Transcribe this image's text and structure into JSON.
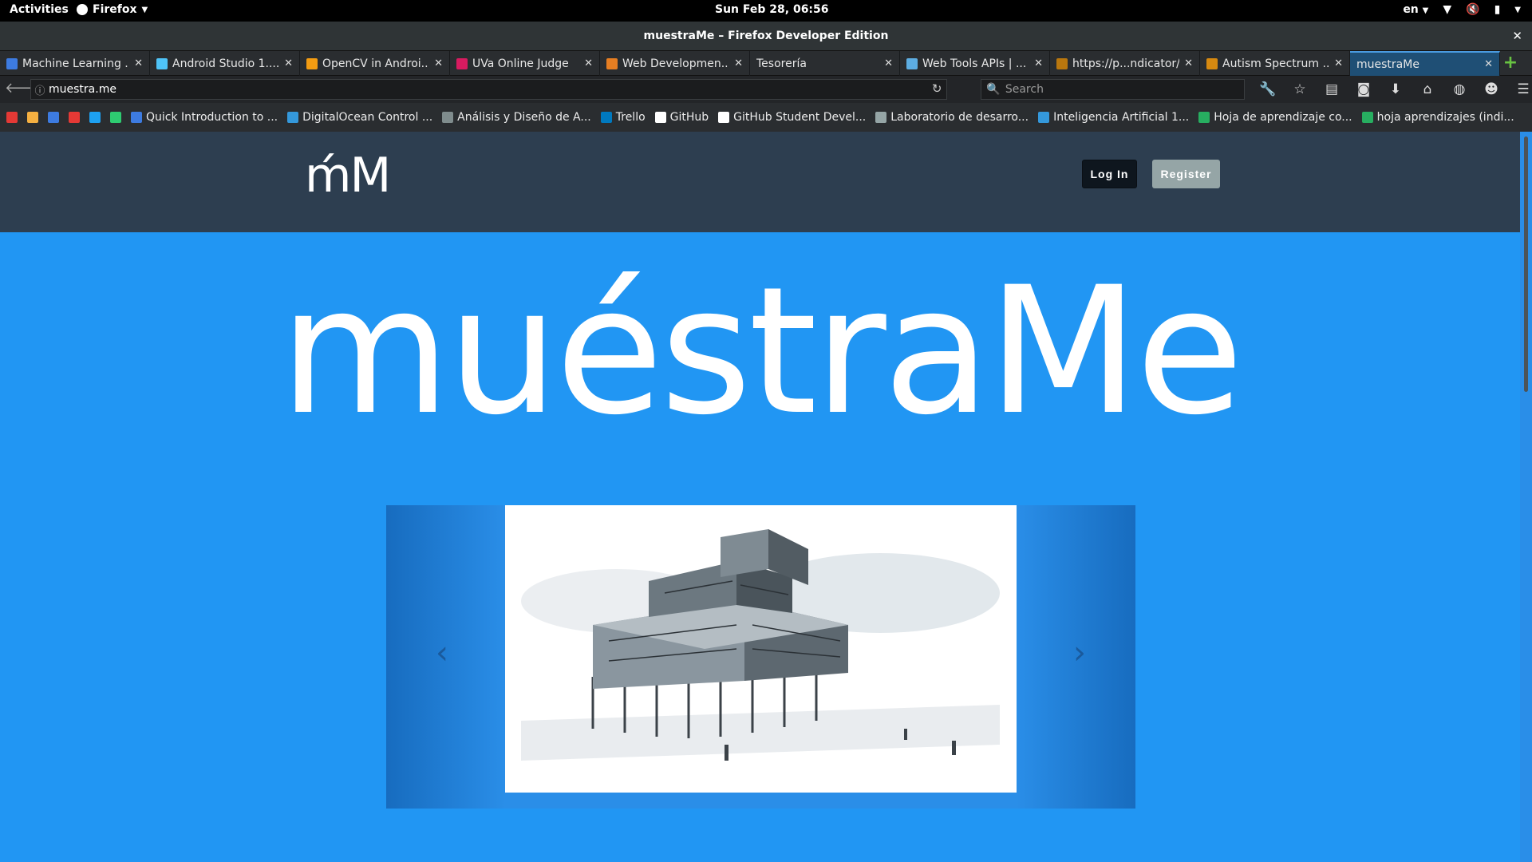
{
  "system_bar": {
    "activities": "Activities",
    "app": "Firefox",
    "clock": "Sun Feb 28, 06:56",
    "lang": "en"
  },
  "window": {
    "title": "muestraMe – Firefox Developer Edition"
  },
  "tabs": [
    {
      "title": "Machine Learning ...",
      "favicon_color": "#3d7be0"
    },
    {
      "title": "Android Studio 1....",
      "favicon_color": "#4fc3f7"
    },
    {
      "title": "OpenCV in Androi...",
      "favicon_color": "#f39c12"
    },
    {
      "title": "UVa Online Judge",
      "favicon_color": "#d81b60"
    },
    {
      "title": "Web Developmen...",
      "favicon_color": "#e67e22"
    },
    {
      "title": "Tesorería",
      "favicon_color": ""
    },
    {
      "title": "Web Tools APIs | ...",
      "favicon_color": "#5dade2"
    },
    {
      "title": "https://p...ndicator/",
      "favicon_color": "#b9770e"
    },
    {
      "title": "Autism Spectrum ...",
      "favicon_color": "#d68910"
    },
    {
      "title": "muestraMe",
      "favicon_color": ""
    }
  ],
  "navbar": {
    "url": "muestra.me",
    "search_placeholder": "Search"
  },
  "bookmarks": [
    {
      "label": "",
      "color": "#e53935"
    },
    {
      "label": "",
      "color": "#f5b041"
    },
    {
      "label": "",
      "color": "#3d7be0"
    },
    {
      "label": "",
      "color": "#e53935"
    },
    {
      "label": "",
      "color": "#1da1f2"
    },
    {
      "label": "",
      "color": "#2ecc71"
    },
    {
      "label": "Quick Introduction to ...",
      "color": "#3d7be0"
    },
    {
      "label": "DigitalOcean Control ...",
      "color": "#3498db"
    },
    {
      "label": "Análisis y Diseño de A...",
      "color": "#7f8c8d"
    },
    {
      "label": "Trello",
      "color": "#0079bf"
    },
    {
      "label": "GitHub",
      "color": "#ffffff"
    },
    {
      "label": "GitHub Student Devel...",
      "color": "#ffffff"
    },
    {
      "label": "Laboratorio de desarro...",
      "color": "#95a5a6"
    },
    {
      "label": "Inteligencia Artificial 1...",
      "color": "#3498db"
    },
    {
      "label": "Hoja de aprendizaje co...",
      "color": "#27ae60"
    },
    {
      "label": "hoja aprendizajes (indi...",
      "color": "#27ae60"
    }
  ],
  "site": {
    "logo": "ḿM",
    "login": "Log In",
    "register": "Register",
    "hero_title": "muéstraMe"
  }
}
